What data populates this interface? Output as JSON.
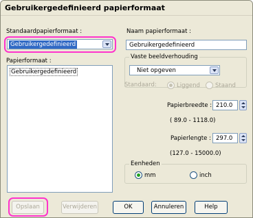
{
  "window": {
    "title": "Gebruikergedefinieerd papierformaat"
  },
  "standard_paper": {
    "label": "Standaardpapierformaat :",
    "selected": "Gebruikergedefinieerd"
  },
  "paper_format": {
    "label": "Papierformaat :",
    "items": [
      "Gebruikergedefinieerd"
    ]
  },
  "paper_name": {
    "label": "Naam papierformaat :",
    "value": "Gebruikergedefinieerd"
  },
  "aspect_ratio": {
    "group_title": "Vaste beeldverhouding",
    "selected": "Niet opgeven",
    "standard_label": "Standaard:",
    "option_portrait": "Liggend",
    "option_landscape": "Staand"
  },
  "paper_width": {
    "label": "Papierbreedte :",
    "value": "210.0",
    "range": "( 89.0 - 1118.0)"
  },
  "paper_length": {
    "label": "Papierlengte :",
    "value": "297.0",
    "range": "(127.0 - 15000.0)"
  },
  "units": {
    "group_title": "Eenheden",
    "option_mm": "mm",
    "option_inch": "inch",
    "selected": "mm"
  },
  "buttons": {
    "save": "Opslaan",
    "delete": "Verwijderen",
    "ok": "OK",
    "cancel": "Annuleren",
    "help": "Help"
  },
  "colors": {
    "highlight": "#ff33cc",
    "dialog_bg": "#ece9d8",
    "selection": "#316ac5"
  }
}
